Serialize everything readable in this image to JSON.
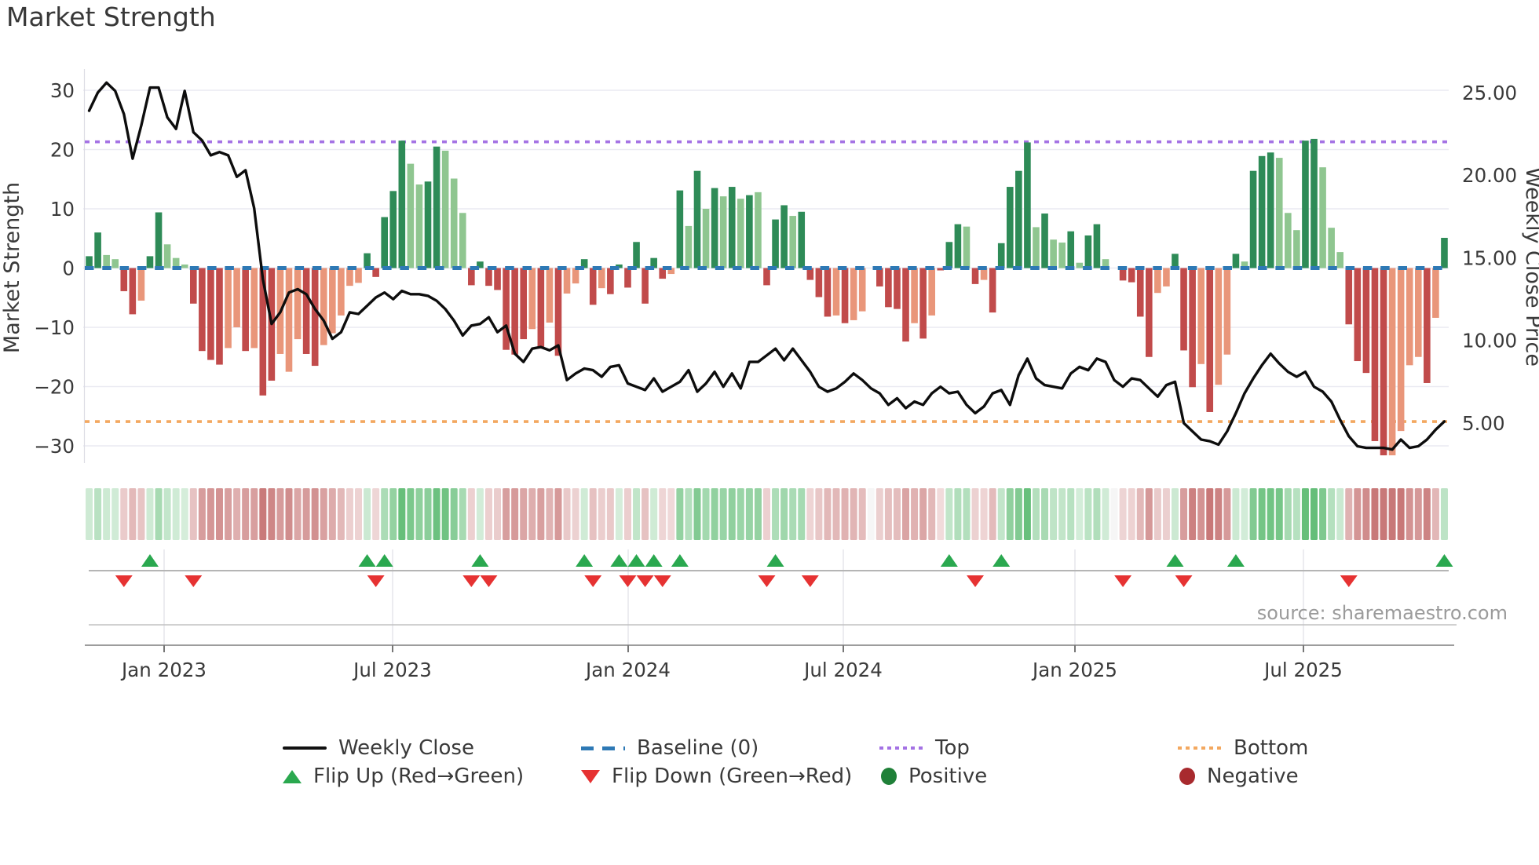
{
  "title": "Market Strength",
  "source": "source: sharemaestro.com",
  "axes": {
    "left_label": "Market Strength",
    "right_label": "Weekly Close Price",
    "left_tick_labels": [
      "30",
      "20",
      "10",
      "0",
      "−10",
      "−20",
      "−30"
    ],
    "left_tick_values": [
      30,
      20,
      10,
      0,
      -10,
      -20,
      -30
    ],
    "right_tick_labels": [
      "25.00",
      "20.00",
      "15.00",
      "10.00",
      "5.00"
    ],
    "right_tick_values": [
      25,
      20,
      15,
      10,
      5
    ],
    "x_tick_labels": [
      "Jan 2023",
      "Jul 2023",
      "Jan 2024",
      "Jul 2024",
      "Jan 2025",
      "Jul 2025"
    ]
  },
  "legend": {
    "weekly_close": "Weekly Close",
    "baseline": "Baseline (0)",
    "top": "Top",
    "bottom": "Bottom",
    "flip_up": "Flip Up (Red→Green)",
    "flip_down": "Flip Down (Green→Red)",
    "positive": "Positive",
    "negative": "Negative"
  },
  "colors": {
    "dark_green": "#2e8b57",
    "light_green": "#8fc690",
    "dark_red": "#c14b4b",
    "light_red": "#e9967a",
    "line_black": "#0d0d0d",
    "baseline_blue": "#2e79b5",
    "top_purple": "#a472e4",
    "bottom_orange": "#f3a860",
    "flip_up_green": "#2aa84f",
    "flip_down_red": "#e63232",
    "positive_dot": "#1f8038",
    "negative_dot": "#a82a2e",
    "grid": "#eaeaf2",
    "axis_text": "#3a3a3a"
  },
  "chart_data": {
    "type": "bar+line combo with heatmap strip and flip markers",
    "title": "Market Strength",
    "ylabel_left": "Market Strength",
    "ylabel_right": "Weekly Close Price",
    "ylim_left": [
      -33,
      33.5
    ],
    "x_range_weeks": 157,
    "top_level": 21.3,
    "baseline_level": 0,
    "bottom_level": -25.9,
    "bar_shades_key": "D=dark green, L=light green, R=dark red, S=light red(salmon), Z=zero",
    "bar_shades": "DDLLRRSDDLLLRRRRSSRSRRSSSRRSSSSSDRDDDLLDDLLLRDRRRRRSRSRSSDRSRDRDRDRSDLDLDLDLDLRDDLDRRRSRSSZRRRRSRSRDDLRSRDDDDLDLLDLDDLZRRRRSSDRRSRSSDLDDDLLLDDLLLRRRRRSSSSRSD",
    "bar_values": [
      2,
      6,
      2.2,
      1.5,
      -3.9,
      -7.8,
      -5.5,
      2,
      9.4,
      4,
      1.7,
      0.6,
      -6,
      -14,
      -15.5,
      -16.3,
      -13.5,
      -10,
      -14,
      -13.5,
      -21.5,
      -19,
      -14.5,
      -17.5,
      -12,
      -14.5,
      -16.5,
      -13,
      -11,
      -8,
      -3,
      -2.5,
      2.5,
      -1.5,
      8.6,
      13,
      21.5,
      17.6,
      14.1,
      14.6,
      20.5,
      19.8,
      15.1,
      9.3,
      -2.9,
      1.1,
      -3,
      -3.7,
      -13.8,
      -14.6,
      -12,
      -10.3,
      -13.6,
      -9.2,
      -14.8,
      -4.3,
      -2.6,
      1.5,
      -6.2,
      -3.4,
      -4.4,
      0.6,
      -3.3,
      4.4,
      -6,
      1.7,
      -1.8,
      -1,
      13.1,
      7.1,
      16.4,
      10,
      13.5,
      12.1,
      13.7,
      11.7,
      12.3,
      12.8,
      -2.9,
      8.2,
      10.6,
      8.8,
      9.5,
      -2,
      -4.9,
      -8.2,
      -8,
      -9.3,
      -8.8,
      -7.3,
      0,
      -3.1,
      -6.6,
      -6.9,
      -12.4,
      -9.3,
      -11.9,
      -8,
      -0.4,
      4.4,
      7.4,
      7,
      -2.7,
      -2,
      -7.5,
      4.2,
      13.7,
      16.4,
      21.2,
      6.9,
      9.2,
      4.8,
      4.3,
      6.2,
      0.9,
      5.5,
      7.4,
      1.5,
      0,
      -2.1,
      -2.4,
      -8.2,
      -15,
      -4.2,
      -3.1,
      2.4,
      -13.9,
      -20.1,
      -16.2,
      -24.3,
      -19.7,
      -14.6,
      2.4,
      1.1,
      16.4,
      18.9,
      19.5,
      18.6,
      9.3,
      6.4,
      21.5,
      21.8,
      17,
      6.8,
      2.7,
      -9.5,
      -15.7,
      -17.7,
      -29.2,
      -31.6,
      -31.6,
      -27.5,
      -16.4,
      -15,
      -19.4,
      -8.4,
      5.1
    ],
    "weekly_close_price": [
      23.9,
      25,
      25.6,
      25.1,
      23.7,
      21,
      23,
      25.3,
      25.3,
      23.5,
      22.8,
      25.1,
      22.6,
      22.1,
      21.2,
      21.4,
      21.2,
      19.9,
      20.3,
      18,
      13.7,
      11,
      11.7,
      12.9,
      13.1,
      12.8,
      11.9,
      11.2,
      10.1,
      10.5,
      11.7,
      11.6,
      12.1,
      12.6,
      12.9,
      12.5,
      13,
      12.8,
      12.8,
      12.7,
      12.4,
      11.9,
      11.2,
      10.3,
      10.9,
      11,
      11.4,
      10.5,
      10.9,
      9.2,
      8.7,
      9.5,
      9.6,
      9.4,
      9.7,
      7.6,
      8,
      8.3,
      8.2,
      7.8,
      8.4,
      8.5,
      7.4,
      7.2,
      7,
      7.7,
      6.9,
      7.2,
      7.5,
      8.2,
      6.9,
      7.4,
      8.1,
      7.2,
      8,
      7.1,
      8.7,
      8.7,
      9.1,
      9.5,
      8.8,
      9.5,
      8.8,
      8.1,
      7.2,
      6.9,
      7.1,
      7.5,
      8,
      7.6,
      7.1,
      6.8,
      6.1,
      6.5,
      5.9,
      6.3,
      6.1,
      6.8,
      7.2,
      6.8,
      6.9,
      6.1,
      5.6,
      6,
      6.8,
      7,
      6.1,
      7.9,
      8.9,
      7.7,
      7.3,
      7.2,
      7.1,
      8,
      8.4,
      8.2,
      8.9,
      8.7,
      7.6,
      7.2,
      7.7,
      7.6,
      7.1,
      6.6,
      7.3,
      7.5,
      5,
      4.5,
      4,
      3.9,
      3.7,
      4.5,
      5.6,
      6.8,
      7.7,
      8.5,
      9.2,
      8.6,
      8.1,
      7.8,
      8.1,
      7.2,
      6.9,
      6.3,
      5.2,
      4.2,
      3.6,
      3.5,
      3.5,
      3.5,
      3.4,
      4,
      3.5,
      3.6,
      4,
      4.6,
      5.1
    ],
    "flip_up_weeks": [
      8,
      33,
      35,
      46,
      58,
      62,
      64,
      66,
      69,
      80,
      100,
      106,
      126,
      133,
      157
    ],
    "flip_down_weeks": [
      5,
      13,
      34,
      45,
      47,
      59,
      63,
      65,
      67,
      79,
      84,
      103,
      120,
      127,
      146
    ],
    "price_to_strength": "strength = (price - 14.38) / 0.3586",
    "legend_position": "bottom center, two rows",
    "grid": "horizontal only in main panel"
  }
}
